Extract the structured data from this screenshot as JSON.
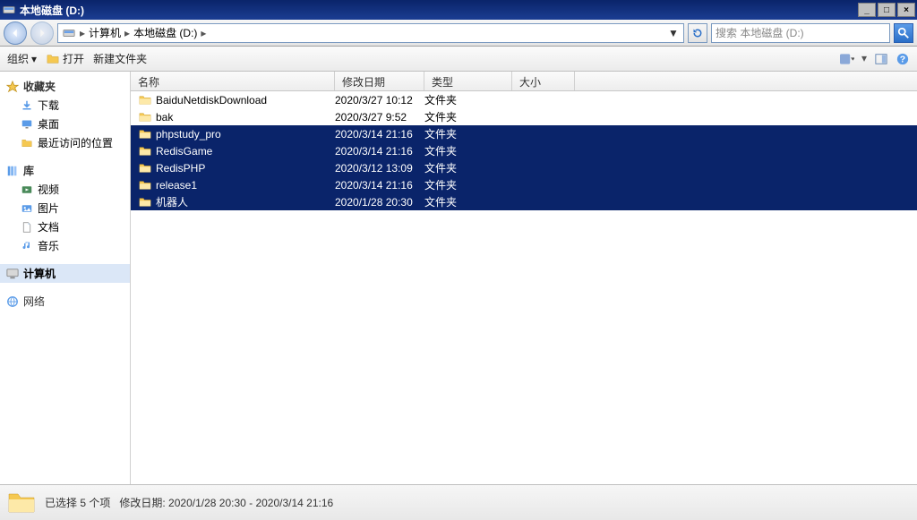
{
  "window": {
    "title": "本地磁盘 (D:)"
  },
  "nav": {
    "breadcrumbs": [
      "计算机",
      "本地磁盘 (D:)"
    ],
    "refresh_dropdown": "▼"
  },
  "search": {
    "placeholder": "搜索 本地磁盘 (D:)"
  },
  "toolbar": {
    "organize": "组织",
    "open": "打开",
    "new_folder": "新建文件夹"
  },
  "navpane": {
    "favorites": {
      "label": "收藏夹",
      "items": [
        "下载",
        "桌面",
        "最近访问的位置"
      ]
    },
    "libraries": {
      "label": "库",
      "items": [
        "视频",
        "图片",
        "文档",
        "音乐"
      ]
    },
    "computer": {
      "label": "计算机"
    },
    "network": {
      "label": "网络"
    }
  },
  "columns": {
    "name": "名称",
    "date": "修改日期",
    "type": "类型",
    "size": "大小"
  },
  "files": [
    {
      "name": "BaiduNetdiskDownload",
      "date": "2020/3/27 10:12",
      "type": "文件夹",
      "selected": false
    },
    {
      "name": "bak",
      "date": "2020/3/27 9:52",
      "type": "文件夹",
      "selected": false
    },
    {
      "name": "phpstudy_pro",
      "date": "2020/3/14 21:16",
      "type": "文件夹",
      "selected": true
    },
    {
      "name": "RedisGame",
      "date": "2020/3/14 21:16",
      "type": "文件夹",
      "selected": true
    },
    {
      "name": "RedisPHP",
      "date": "2020/3/12 13:09",
      "type": "文件夹",
      "selected": true
    },
    {
      "name": "release1",
      "date": "2020/3/14 21:16",
      "type": "文件夹",
      "selected": true
    },
    {
      "name": "机器人",
      "date": "2020/1/28 20:30",
      "type": "文件夹",
      "selected": true
    }
  ],
  "status": {
    "count_label": "已选择 5 个项",
    "date_label": "修改日期:",
    "date_range": "2020/1/28 20:30 - 2020/3/14 21:16"
  }
}
